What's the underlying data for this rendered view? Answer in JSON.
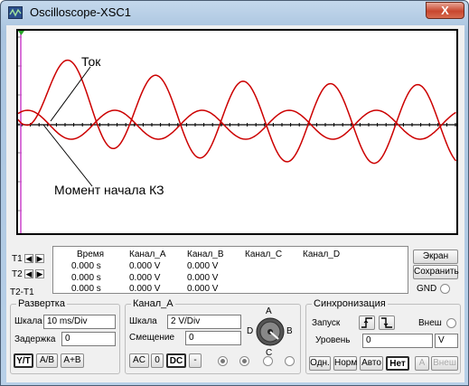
{
  "window": {
    "title": "Oscilloscope-XSC1",
    "close_label": "X"
  },
  "screen": {
    "annotations": {
      "current": "Ток",
      "fault_start": "Момент начала КЗ"
    },
    "colors": {
      "trace_a": "#cc0000",
      "trace_b": "#cc0000",
      "axis": "#000000",
      "grid": "#888888",
      "cursor": "#cc44cc"
    }
  },
  "cursors": {
    "t1": "T1",
    "t2": "T2",
    "t2_t1": "T2-T1"
  },
  "readout": {
    "headers": {
      "time": "Время",
      "ch_a": "Канал_A",
      "ch_b": "Канал_B",
      "ch_c": "Канал_C",
      "ch_d": "Канал_D"
    },
    "rows": [
      {
        "time": "0.000 s",
        "a": "0.000 V",
        "b": "0.000 V"
      },
      {
        "time": "0.000 s",
        "a": "0.000 V",
        "b": "0.000 V"
      },
      {
        "time": "0.000 s",
        "a": "0.000 V",
        "b": "0.000 V"
      }
    ]
  },
  "side_buttons": {
    "reverse": "Экран",
    "save": "Сохранить",
    "gnd": "GND"
  },
  "timebase": {
    "title": "Развертка",
    "scale_label": "Шкала",
    "scale_value": "10 ms/Div",
    "delay_label": "Задержка",
    "delay_value": "0",
    "mode_yt": "Y/T",
    "mode_ab": "A/B",
    "mode_apb": "A+B"
  },
  "channel_a": {
    "title": "Канал_A",
    "scale_label": "Шкала",
    "scale_value": "2  V/Div",
    "offset_label": "Смещение",
    "offset_value": "0",
    "ac": "AC",
    "zero": "0",
    "dc": "DC",
    "minus": "-"
  },
  "knob": {
    "a": "A",
    "b": "B",
    "c": "C",
    "d": "D"
  },
  "trigger": {
    "title": "Синхронизация",
    "edge_label": "Запуск",
    "ext_label": "Внеш",
    "level_label": "Уровень",
    "level_value": "0",
    "level_unit": "V",
    "single": "Одн.",
    "normal": "Норм",
    "auto": "Авто",
    "none": "Нет",
    "a": "A",
    "ext": "Внеш"
  }
}
